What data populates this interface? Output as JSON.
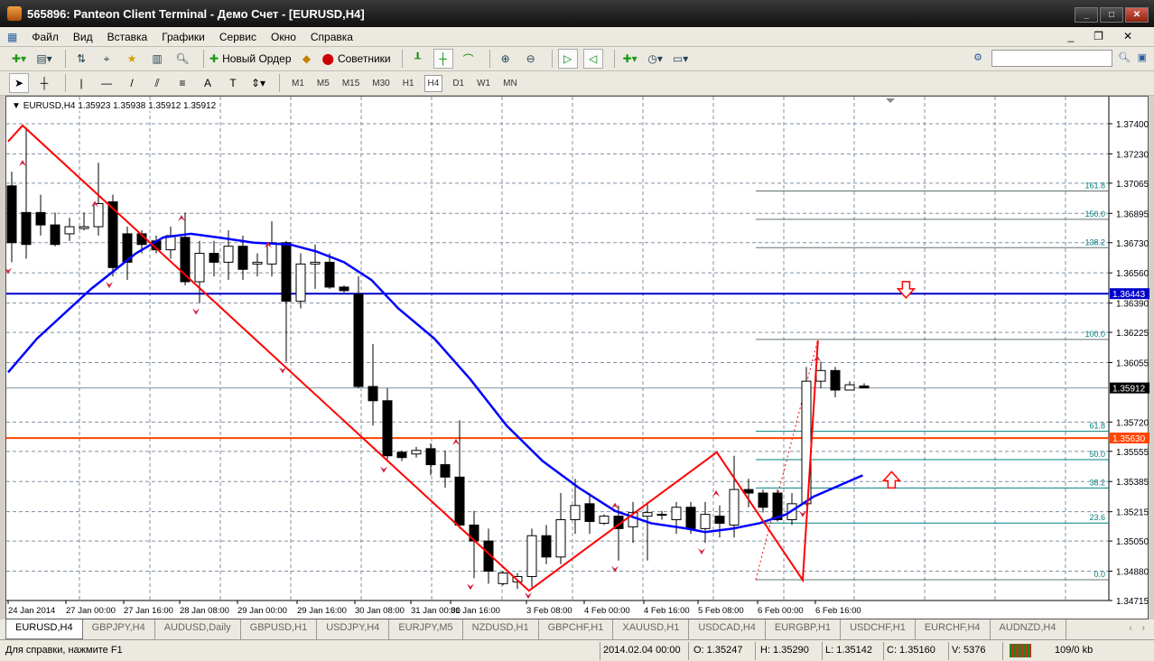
{
  "window": {
    "title": "565896: Panteon Client Terminal - Демо Счет - [EURUSD,H4]"
  },
  "menu": [
    "Файл",
    "Вид",
    "Вставка",
    "Графики",
    "Сервис",
    "Окно",
    "Справка"
  ],
  "toolbar": {
    "new_order": "Новый Ордер",
    "experts": "Советники"
  },
  "timeframes": [
    "M1",
    "M5",
    "M15",
    "M30",
    "H1",
    "H4",
    "D1",
    "W1",
    "MN"
  ],
  "active_timeframe": "H4",
  "drawing_tools": {
    "text_label": "A"
  },
  "chart_header": "EURUSD,H4  1.35923 1.35938 1.35912 1.35912",
  "chart_data": {
    "type": "candlestick",
    "symbol": "EURUSD",
    "timeframe": "H4",
    "ylim": [
      1.3469,
      1.3753
    ],
    "price_ticks": [
      "1.37400",
      "1.37230",
      "1.37065",
      "1.36895",
      "1.36730",
      "1.36560",
      "1.36390",
      "1.36225",
      "1.36055",
      "1.35720",
      "1.35555",
      "1.35385",
      "1.35215",
      "1.35050",
      "1.34880",
      "1.34715"
    ],
    "time_ticks": [
      [
        "24 Jan 2014",
        -0.25
      ],
      [
        "27 Jan 00:00",
        4
      ],
      [
        "27 Jan 16:00",
        8.9
      ],
      [
        "28 Jan 08:00",
        13.7
      ],
      [
        "29 Jan 00:00",
        18.5
      ],
      [
        "29 Jan 16:00",
        23.5
      ],
      [
        "30 Jan 08:00",
        28.3
      ],
      [
        "31 Jan 00:00",
        33.2
      ],
      [
        "31 Jan 16:00",
        38
      ],
      [
        "3 Feb 08:00",
        36
      ],
      [
        "4 Feb 00:00",
        40
      ],
      [
        "4 Feb 16:00",
        44.8
      ],
      [
        "5 Feb 08:00",
        49.7
      ],
      [
        "6 Feb 00:00",
        54.6
      ],
      [
        "6 Feb 16:00",
        59.5
      ]
    ],
    "candles": [
      [
        1.3705,
        1.3713,
        1.3662,
        1.3673
      ],
      [
        1.369,
        1.3738,
        1.3664,
        1.3672
      ],
      [
        1.369,
        1.37,
        1.3677,
        1.3683
      ],
      [
        1.3683,
        1.369,
        1.3671,
        1.3672
      ],
      [
        1.3678,
        1.3687,
        1.3674,
        1.3682
      ],
      [
        1.3681,
        1.369,
        1.368,
        1.3682
      ],
      [
        1.3682,
        1.3718,
        1.3677,
        1.3695
      ],
      [
        1.3696,
        1.37,
        1.3654,
        1.3659
      ],
      [
        1.3678,
        1.3682,
        1.3652,
        1.3662
      ],
      [
        1.3678,
        1.368,
        1.3667,
        1.3672
      ],
      [
        1.3674,
        1.3677,
        1.3667,
        1.3669
      ],
      [
        1.3669,
        1.3682,
        1.3664,
        1.3677
      ],
      [
        1.3676,
        1.369,
        1.3649,
        1.3651
      ],
      [
        1.3651,
        1.3674,
        1.3639,
        1.3667
      ],
      [
        1.3667,
        1.3674,
        1.3654,
        1.3662
      ],
      [
        1.3662,
        1.368,
        1.3652,
        1.3671
      ],
      [
        1.3671,
        1.3677,
        1.3652,
        1.3658
      ],
      [
        1.3661,
        1.3667,
        1.3654,
        1.3662
      ],
      [
        1.3661,
        1.3685,
        1.3654,
        1.3673
      ],
      [
        1.3673,
        1.3674,
        1.3606,
        1.364
      ],
      [
        1.364,
        1.3667,
        1.3636,
        1.3661
      ],
      [
        1.3661,
        1.3672,
        1.3647,
        1.3662
      ],
      [
        1.3662,
        1.3667,
        1.3647,
        1.3648
      ],
      [
        1.3648,
        1.3649,
        1.3645,
        1.3646
      ],
      [
        1.3644,
        1.3654,
        1.3591,
        1.3592
      ],
      [
        1.3592,
        1.3616,
        1.357,
        1.3584
      ],
      [
        1.3584,
        1.3591,
        1.355,
        1.3553
      ],
      [
        1.3555,
        1.3556,
        1.355,
        1.3552
      ],
      [
        1.3554,
        1.3558,
        1.3552,
        1.3556
      ],
      [
        1.3557,
        1.356,
        1.3542,
        1.3548
      ],
      [
        1.3548,
        1.3556,
        1.3535,
        1.3541
      ],
      [
        1.3541,
        1.3573,
        1.3512,
        1.3514
      ],
      [
        1.3514,
        1.3522,
        1.3484,
        1.3505
      ],
      [
        1.3505,
        1.3512,
        1.3481,
        1.3488
      ],
      [
        1.3481,
        1.3488,
        1.348,
        1.3487
      ],
      [
        1.3482,
        1.3487,
        1.3478,
        1.3485
      ],
      [
        1.3485,
        1.3512,
        1.3479,
        1.3508
      ],
      [
        1.3508,
        1.3514,
        1.3492,
        1.3496
      ],
      [
        1.3496,
        1.3532,
        1.3492,
        1.3517
      ],
      [
        1.3517,
        1.354,
        1.3509,
        1.3525
      ],
      [
        1.3526,
        1.3532,
        1.3509,
        1.3516
      ],
      [
        1.3515,
        1.352,
        1.3514,
        1.3519
      ],
      [
        1.3519,
        1.3525,
        1.3494,
        1.3512
      ],
      [
        1.3513,
        1.3527,
        1.3504,
        1.3521
      ],
      [
        1.3519,
        1.3527,
        1.3494,
        1.3521
      ],
      [
        1.352,
        1.3522,
        1.3517,
        1.352
      ],
      [
        1.3517,
        1.3527,
        1.3509,
        1.3524
      ],
      [
        1.3524,
        1.3527,
        1.3509,
        1.3512
      ],
      [
        1.3512,
        1.3527,
        1.3504,
        1.352
      ],
      [
        1.3519,
        1.3525,
        1.3507,
        1.3515
      ],
      [
        1.3514,
        1.3553,
        1.3507,
        1.3534
      ],
      [
        1.3534,
        1.354,
        1.3524,
        1.3532
      ],
      [
        1.3532,
        1.3534,
        1.3521,
        1.3524
      ],
      [
        1.3532,
        1.3534,
        1.3516,
        1.3517
      ],
      [
        1.3517,
        1.3532,
        1.3514,
        1.3526
      ],
      [
        1.3526,
        1.3603,
        1.3525,
        1.3595
      ],
      [
        1.3595,
        1.3606,
        1.3591,
        1.3601
      ],
      [
        1.3601,
        1.3603,
        1.3586,
        1.359
      ],
      [
        1.359,
        1.3595,
        1.359,
        1.3593
      ],
      [
        1.35923,
        1.35938,
        1.35912,
        1.35912
      ]
    ],
    "moving_average": [
      [
        -0.25,
        1.36
      ],
      [
        1.75,
        1.3619
      ],
      [
        5.5,
        1.3647
      ],
      [
        8.6,
        1.3667
      ],
      [
        10.5,
        1.3676
      ],
      [
        12.4,
        1.3678
      ],
      [
        14.25,
        1.3676
      ],
      [
        16.75,
        1.3673
      ],
      [
        19.25,
        1.3672
      ],
      [
        21.1,
        1.3668
      ],
      [
        23,
        1.3662
      ],
      [
        24.9,
        1.3652
      ],
      [
        26.75,
        1.3636
      ],
      [
        29.25,
        1.3619
      ],
      [
        31.75,
        1.3596
      ],
      [
        34.25,
        1.357
      ],
      [
        36.75,
        1.355
      ],
      [
        39.25,
        1.3535
      ],
      [
        41.75,
        1.3522
      ],
      [
        44.25,
        1.3515
      ],
      [
        46.75,
        1.3512
      ],
      [
        48,
        1.351
      ],
      [
        49.9,
        1.3512
      ],
      [
        51.75,
        1.3515
      ],
      [
        53.6,
        1.352
      ],
      [
        55.5,
        1.353
      ],
      [
        58.9,
        1.3542
      ]
    ],
    "zigzag": [
      [
        -0.25,
        1.373
      ],
      [
        0.75,
        1.3739
      ],
      [
        35.8,
        1.3477
      ],
      [
        48.8,
        1.3555
      ],
      [
        54.75,
        1.3483
      ],
      [
        55.8,
        1.3618
      ]
    ],
    "fibonacci": {
      "start_index": 51.5,
      "price_0": 1.34832,
      "price_100": 1.36185,
      "levels": [
        "0.0",
        "23.6",
        "38.2",
        "50.0",
        "61.8",
        "100.0",
        "138.2",
        "150.0",
        "161.8"
      ]
    },
    "hlines": [
      {
        "price": 1.36443,
        "label": "1.36443",
        "color": "#0000cc"
      },
      {
        "price": 1.3563,
        "label": "1.35630",
        "color": "#ff4500"
      }
    ],
    "current_price": {
      "price": 1.35912,
      "label": "1.35912"
    },
    "arrows": [
      {
        "dir": "down",
        "index": 61.9,
        "price": 1.3645
      },
      {
        "dir": "up",
        "index": 60.9,
        "price": 1.3541
      }
    ],
    "fractals_up": [
      0.75,
      5.75,
      11.75,
      17.75,
      30.75,
      41.75,
      48.75,
      55.75
    ],
    "fractals_down": [
      -0.25,
      6.75,
      12.75,
      18.75,
      25.75,
      31.75,
      35.75,
      41.75,
      47.75,
      54.75
    ]
  },
  "symbol_tabs": [
    "EURUSD,H4",
    "GBPJPY,H4",
    "AUDUSD,Daily",
    "GBPUSD,H1",
    "USDJPY,H4",
    "EURJPY,M5",
    "NZDUSD,H1",
    "GBPCHF,H1",
    "XAUUSD,H1",
    "USDCAD,H4",
    "EURGBP,H1",
    "USDCHF,H1",
    "EURCHF,H4",
    "AUDNZD,H4"
  ],
  "status": {
    "help": "Для справки, нажмите F1",
    "datetime": "2014.02.04 00:00",
    "open": "O: 1.35247",
    "high": "H: 1.35290",
    "low": "L: 1.35142",
    "close": "C: 1.35160",
    "volume": "V: 5376",
    "traffic": "109/0 kb"
  },
  "colors": {
    "bull": "#ffffff",
    "bear": "#000000",
    "ma": "#0000ff",
    "zigzag": "#ff0000",
    "fib": "#008080",
    "grid": "#8090a0"
  }
}
